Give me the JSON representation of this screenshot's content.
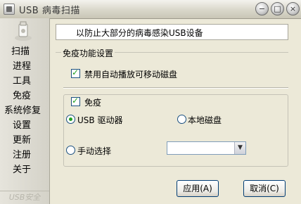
{
  "window": {
    "title": "USB 病毒扫描",
    "controls": [
      "minimize",
      "maximize",
      "close"
    ],
    "control_glyphs": {
      "minimize": "−",
      "maximize": "□",
      "close": "×"
    }
  },
  "sidebar": {
    "items": [
      {
        "label": "扫描"
      },
      {
        "label": "进程"
      },
      {
        "label": "工具"
      },
      {
        "label": "免疫"
      },
      {
        "label": "系统修复"
      },
      {
        "label": "设置"
      },
      {
        "label": "更新"
      },
      {
        "label": "注册"
      },
      {
        "label": "关于"
      }
    ],
    "footer": "USB安全"
  },
  "banner": {
    "text": "以防止大部分的病毒感染USB设备"
  },
  "immunity": {
    "group_title": "免疫功能设置",
    "disable_autoplay": {
      "label": "禁用自动播放可移动磁盘",
      "checked": true
    },
    "immune": {
      "label": "免疫",
      "checked": true
    },
    "options": [
      {
        "label": "USB 驱动器",
        "selected": true
      },
      {
        "label": "本地磁盘",
        "selected": false
      },
      {
        "label": "手动选择",
        "selected": false
      }
    ],
    "manual_select_value": ""
  },
  "buttons": {
    "apply": "应用(A)",
    "cancel": "取消(C)"
  },
  "colors": {
    "check_mark": "#21a121",
    "control_border": "#1c5180",
    "button_border": "#003c74"
  }
}
